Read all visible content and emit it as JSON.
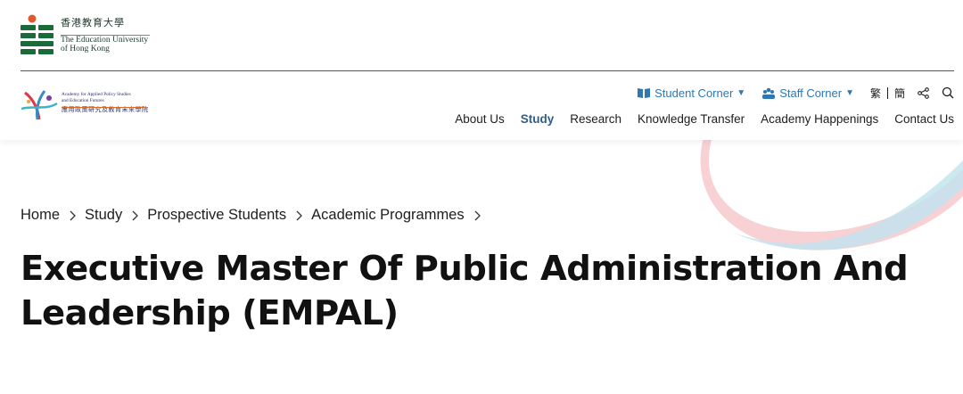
{
  "university": {
    "name_zh": "香港教育大學",
    "name_en_line1": "The Education University",
    "name_en_line2": "of Hong Kong"
  },
  "academy": {
    "name_en_line1": "Academy for Applied Policy Studies",
    "name_en_line2": "and Education Futures",
    "name_zh": "應用政策研究及教育未來學院"
  },
  "utility": {
    "student_corner": "Student Corner",
    "staff_corner": "Staff Corner",
    "lang_trad": "繁",
    "lang_simp": "簡"
  },
  "nav": {
    "items": [
      "About Us",
      "Study",
      "Research",
      "Knowledge Transfer",
      "Academy Happenings",
      "Contact Us"
    ],
    "active": "Study"
  },
  "breadcrumb": [
    "Home",
    "Study",
    "Prospective Students",
    "Academic Programmes"
  ],
  "page": {
    "title": "Executive Master Of Public Administration And Leadership (EMPAL)"
  },
  "colors": {
    "accent_blue": "#2f77b0",
    "active_nav": "#2c5f8a",
    "uni_green": "#1a6b3a",
    "uni_orange": "#e2572b"
  }
}
